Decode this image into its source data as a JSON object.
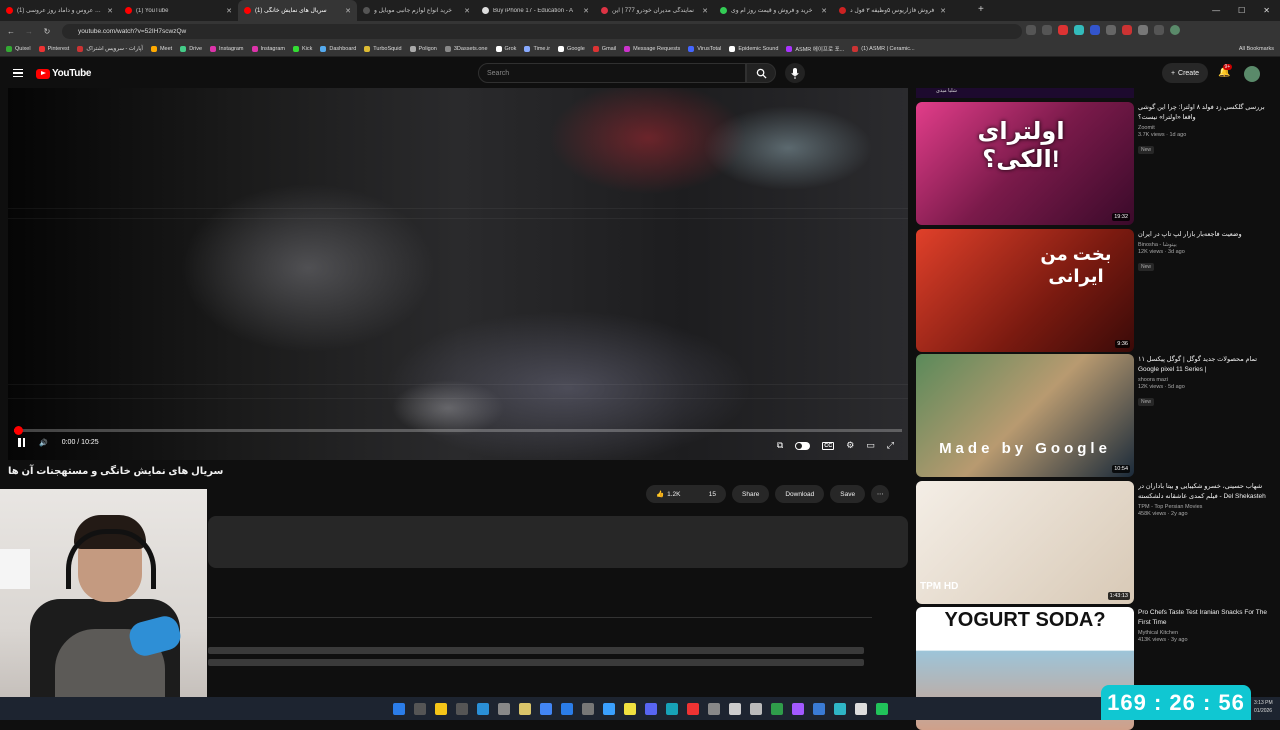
{
  "browser": {
    "tabs": [
      {
        "title": "(1) تازه عروس و داماد روز عروسی",
        "color": "#ff0000"
      },
      {
        "title": "(1) YouTube",
        "color": "#ff0000"
      },
      {
        "title": "(1) سریال های نمایش خانگی",
        "color": "#ff0000"
      },
      {
        "title": "خرید انواع لوازم جانبی موبایل و",
        "color": "#555555"
      },
      {
        "title": "Buy iPhone 17 - Education - A",
        "color": "#dddddd"
      },
      {
        "title": "نمایندگی مدیران خودرو 777 | این",
        "color": "#dd3344"
      },
      {
        "title": "خرید و فروش و قیمت روز ام وی",
        "color": "#33cc55"
      },
      {
        "title": "فروش فازاریوس ۵وظیفه ۳ فول د",
        "color": "#cc2222"
      }
    ],
    "url": "youtube.com/watch?v=52IH7scwzQw",
    "bookmarks": [
      "Quixel",
      "Pinterest",
      "آپارات - سرویس اشتراک",
      "Meet",
      "Drive",
      "Instagram",
      "Instagram",
      "Kick",
      "Dashboard",
      "TurboSquid",
      "Poligon",
      "3Dassets.one",
      "Grok",
      "Time.ir",
      "Google",
      "Gmail",
      "Message Requests",
      "VirusTotal",
      "Epidemic Sound",
      "ASMR 에이프로 포...",
      "(1) ASMR | Ceramic..."
    ],
    "all_bookmarks": "All Bookmarks"
  },
  "youtube": {
    "logo_text": "YouTube",
    "search_placeholder": "Search",
    "create_label": "Create",
    "notif_count": "9+"
  },
  "player": {
    "time": "0:00 / 10:25",
    "progress_fraction": 0.005
  },
  "video": {
    "title": "سریال های نمایش خانگی و مستهجنات آن ها",
    "likes": "1.2K",
    "dislikes": "15",
    "share": "Share",
    "download": "Download",
    "save": "Save"
  },
  "sidebar": {
    "top_strip": "شلیا میدی",
    "items": [
      {
        "title": "بررسی گلکسی زد فولد ۸ اولترا: چرا این گوشی واقعا «اولترا» نیست؟",
        "channel": "Zoomit",
        "stats": "3.7K views · 1d ago",
        "badge": "New",
        "duration": "19:32",
        "thumb_text": "اولترای الکی؟!"
      },
      {
        "title": "وضعیت فاجعه‌بار بازار لپ تاپ در ایران",
        "channel": "Binosha - بینوشا",
        "stats": "12K views · 3d ago",
        "badge": "New",
        "duration": "9:36",
        "thumb_text": "بخت من ایرانی"
      },
      {
        "title": "تمام محصولات جدید گوگل | گوگل پیکسل ۱۱ Google pixel 11 Series |",
        "channel": "shoora mazi",
        "stats": "12K views · 5d ago",
        "badge": "New",
        "duration": "10:54",
        "thumb_text": "Made by Google"
      },
      {
        "title": "شهاب حسینی، خسرو شکیبایی و بیتا باداران در فیلم کمدی عاشقانه دلشکسته - Del Shekasteh Film Irani",
        "channel": "TPM - Top Persian Movies",
        "stats": "458K views · 2y ago",
        "badge": "",
        "duration": "1:43:13",
        "thumb_text": "TPM HD"
      },
      {
        "title": "Pro Chefs Taste Test Iranian Snacks For The First Time",
        "channel": "Mythical Kitchen",
        "stats": "413K views · 3y ago",
        "badge": "",
        "duration": "",
        "thumb_text": "YOGURT SODA?"
      }
    ]
  },
  "overlay": {
    "timer": "169 : 26 : 56",
    "clock_time": "3:13 PM",
    "clock_date": "01/2026"
  },
  "colors": {
    "accent": "#ff0000",
    "timer_bg": "#10c7d2"
  }
}
